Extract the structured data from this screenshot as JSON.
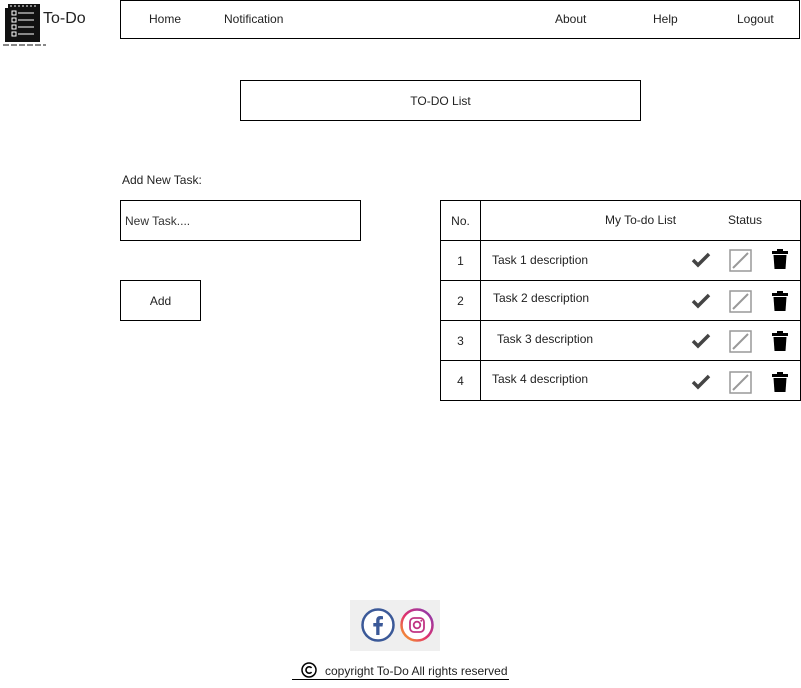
{
  "app": {
    "name": "To-Do"
  },
  "nav": {
    "home": "Home",
    "notification": "Notification",
    "about": "About",
    "help": "Help",
    "logout": "Logout"
  },
  "page": {
    "title": "TO-DO List"
  },
  "add_task": {
    "label": "Add New Task:",
    "placeholder": "New Task....",
    "button": "Add"
  },
  "table": {
    "headers": {
      "no": "No.",
      "list": "My To-do List",
      "status": "Status"
    },
    "rows": [
      {
        "no": "1",
        "description": "Task 1 description"
      },
      {
        "no": "2",
        "description": "Task 2 description"
      },
      {
        "no": "3",
        "description": "Task 3 description"
      },
      {
        "no": "4",
        "description": "Task 4 description"
      }
    ],
    "status_icons": [
      "check-icon",
      "edit-icon",
      "trash-icon"
    ]
  },
  "footer": {
    "social_icons": [
      "facebook-icon",
      "instagram-icon"
    ],
    "copyright": "copyright To-Do All rights reserved"
  },
  "colors": {
    "border": "#000000",
    "check": "#444444",
    "edit": "#999999",
    "trash": "#000000"
  }
}
